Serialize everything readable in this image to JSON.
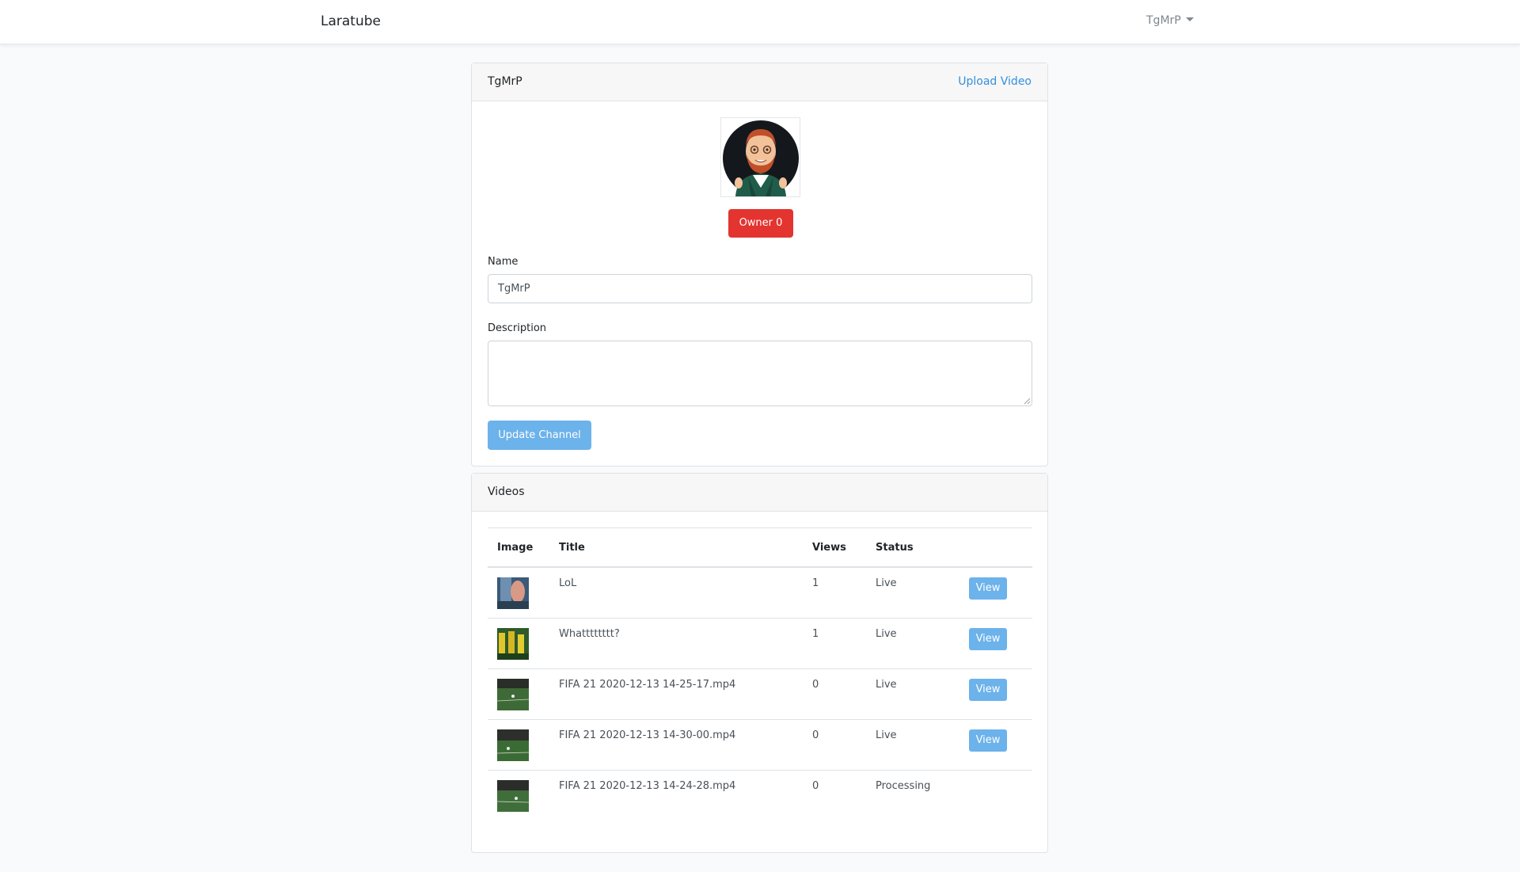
{
  "navbar": {
    "brand": "Laratube",
    "user": "TgMrP"
  },
  "channel": {
    "header_title": "TgMrP",
    "upload_link": "Upload Video",
    "owner_label": "Owner 0",
    "name_label": "Name",
    "name_value": "TgMrP",
    "description_label": "Description",
    "description_value": "",
    "submit_label": "Update Channel"
  },
  "videos": {
    "header_title": "Videos",
    "columns": [
      "Image",
      "Title",
      "Views",
      "Status",
      ""
    ],
    "view_label": "View",
    "rows": [
      {
        "title": "LoL",
        "views": "1",
        "status": "Live",
        "has_view": true,
        "thumb": "blurred-hand"
      },
      {
        "title": "Whatttttttt?",
        "views": "1",
        "status": "Live",
        "has_view": true,
        "thumb": "green-yellow-crowd"
      },
      {
        "title": "FIFA 21 2020-12-13 14-25-17.mp4",
        "views": "0",
        "status": "Live",
        "has_view": true,
        "thumb": "football-pitch"
      },
      {
        "title": "FIFA 21 2020-12-13 14-30-00.mp4",
        "views": "0",
        "status": "Live",
        "has_view": true,
        "thumb": "football-pitch"
      },
      {
        "title": "FIFA 21 2020-12-13 14-24-28.mp4",
        "views": "0",
        "status": "Processing",
        "has_view": false,
        "thumb": "football-pitch"
      }
    ]
  },
  "colors": {
    "primary": "#3490dc",
    "primary_light": "#6cb2eb",
    "danger": "#e3342f",
    "page_bg": "#f8fafc"
  }
}
